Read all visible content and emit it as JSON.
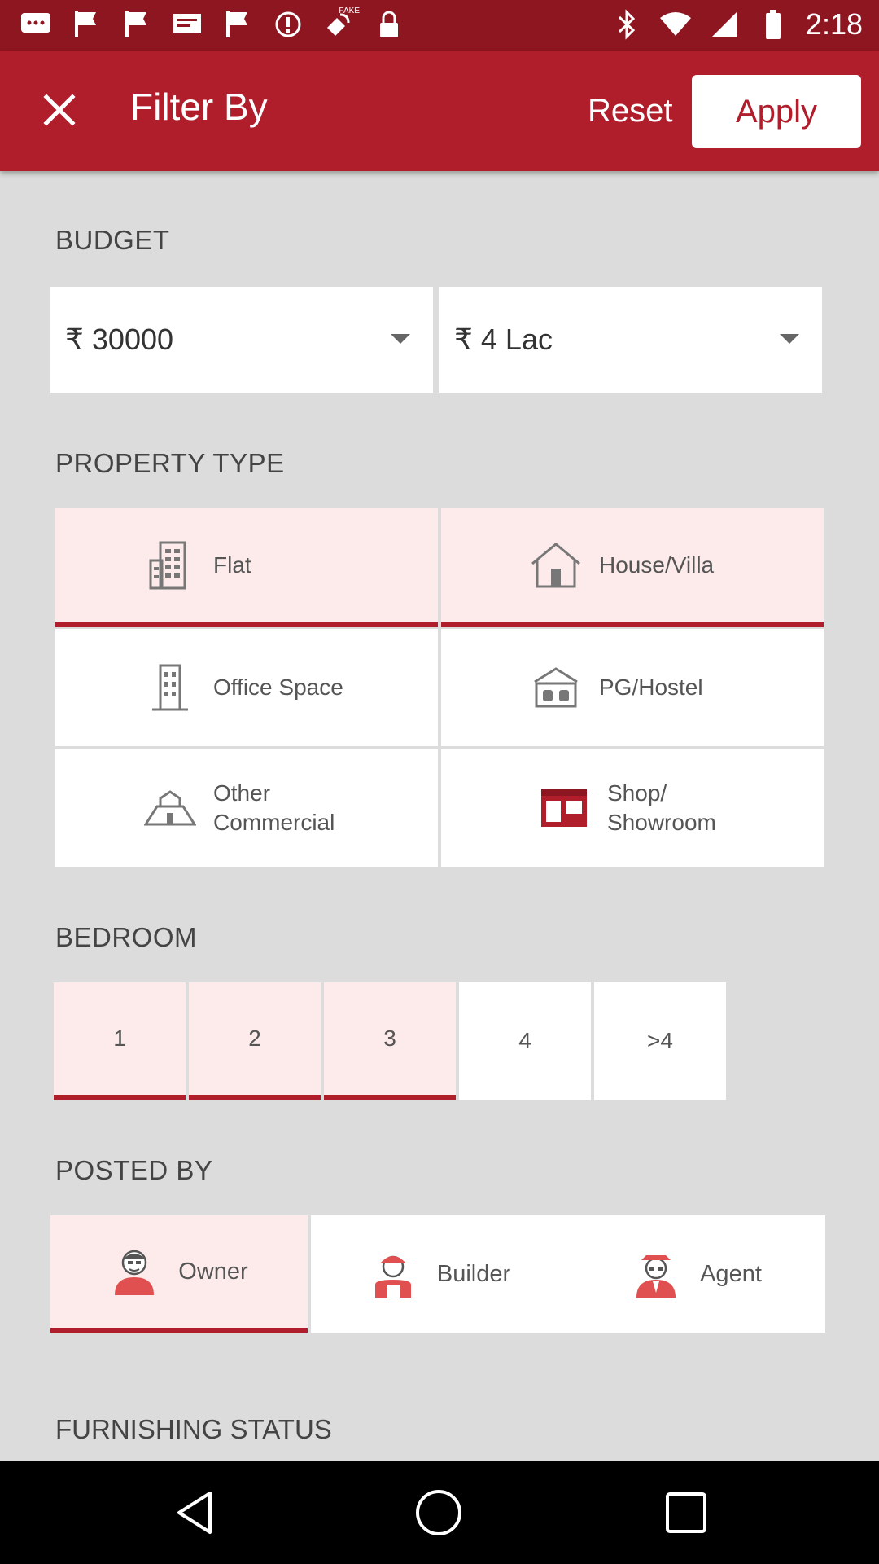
{
  "status_bar": {
    "time": "2:18",
    "fake_label": "FAKE"
  },
  "header": {
    "title": "Filter By",
    "reset_label": "Reset",
    "apply_label": "Apply"
  },
  "budget": {
    "label": "BUDGET",
    "min": {
      "value": "₹ 30000"
    },
    "max": {
      "value": "₹ 4 Lac"
    }
  },
  "property_type": {
    "label": "PROPERTY TYPE",
    "items": [
      {
        "label": "Flat",
        "selected": true,
        "icon": "building-icon"
      },
      {
        "label": "House/Villa",
        "selected": true,
        "icon": "house-icon"
      },
      {
        "label": "Office Space",
        "selected": false,
        "icon": "office-building-icon"
      },
      {
        "label": "PG/Hostel",
        "selected": false,
        "icon": "hostel-icon"
      },
      {
        "label": "Other Commercial",
        "selected": false,
        "icon": "commercial-icon"
      },
      {
        "label": "Shop/ Showroom",
        "selected": false,
        "icon": "shop-icon"
      }
    ]
  },
  "bedroom": {
    "label": "BEDROOM",
    "options": [
      {
        "label": "1",
        "selected": true
      },
      {
        "label": "2",
        "selected": true
      },
      {
        "label": "3",
        "selected": true
      },
      {
        "label": "4",
        "selected": false
      },
      {
        "label": ">4",
        "selected": false
      }
    ]
  },
  "posted_by": {
    "label": "POSTED  BY",
    "options": [
      {
        "label": "Owner",
        "selected": true,
        "icon": "owner-icon"
      },
      {
        "label": "Builder",
        "selected": false,
        "icon": "builder-icon"
      },
      {
        "label": "Agent",
        "selected": false,
        "icon": "agent-icon"
      }
    ]
  },
  "furnishing": {
    "label": "FURNISHING  STATUS"
  },
  "colors": {
    "primary": "#b01e2c",
    "status_bar": "#8e1620",
    "selected_bg": "#fdeaea",
    "page_bg": "#dcdcdc"
  }
}
